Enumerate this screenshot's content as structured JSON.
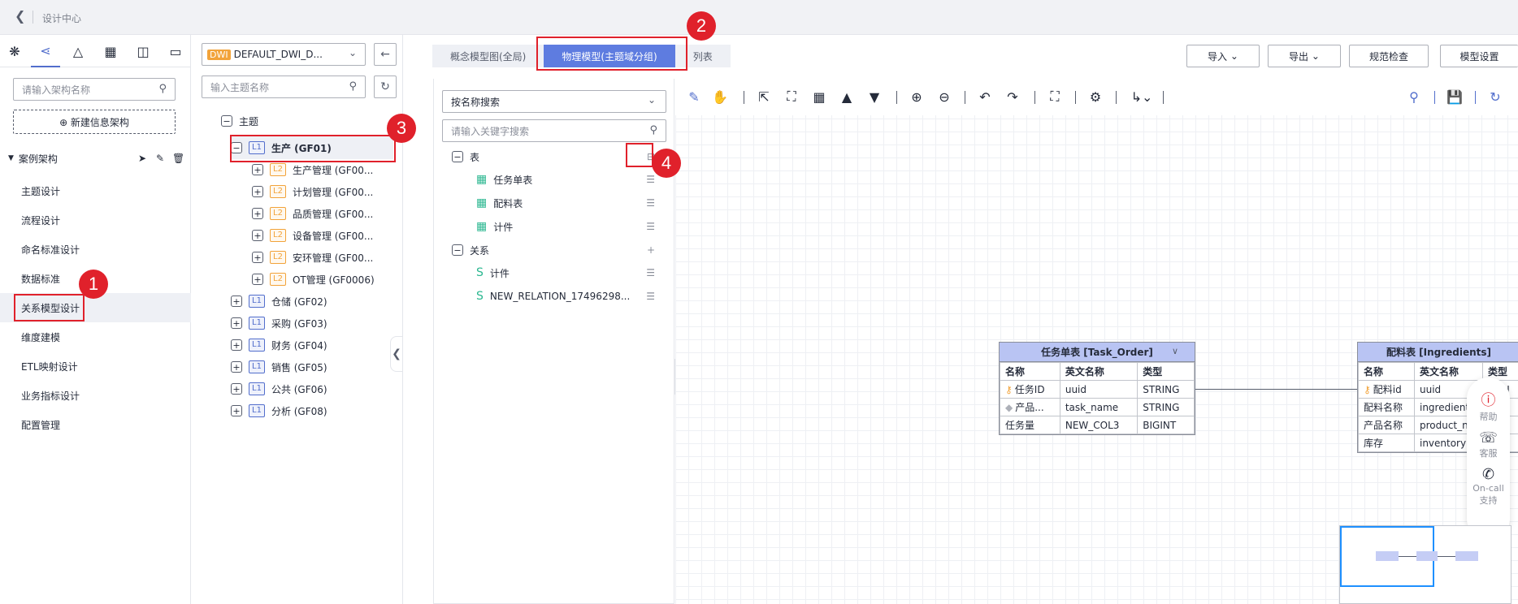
{
  "topbar": {
    "back_icon": "chevron-left-icon",
    "title": "设计中心"
  },
  "left1": {
    "search_placeholder": "请输入架构名称",
    "new_label": "⊕ 新建信息架构",
    "case_label": "案例架构",
    "nav": [
      "主题设计",
      "流程设计",
      "命名标准设计",
      "数据标准",
      "关系模型设计",
      "维度建模",
      "ETL映射设计",
      "业务指标设计",
      "配置管理"
    ],
    "active_nav": "关系模型设计"
  },
  "left2": {
    "workspace_tag": "DWI",
    "workspace": "DEFAULT_DWI_D...",
    "search_placeholder": "输入主题名称",
    "root": "主题",
    "l1_tag": "L1",
    "l2_tag": "L2",
    "selected": "生产 (GF01)",
    "children": [
      "生产管理 (GF00...",
      "计划管理 (GF00...",
      "品质管理 (GF00...",
      "设备管理 (GF00...",
      "安环管理 (GF00...",
      "OT管理 (GF0006)"
    ],
    "others": [
      "仓储 (GF02)",
      "采购 (GF03)",
      "财务 (GF04)",
      "销售 (GF05)",
      "公共 (GF06)",
      "分析 (GF08)"
    ]
  },
  "tabs": [
    "概念模型图(全局)",
    "物理模型(主题域分组)",
    "列表"
  ],
  "active_tab": "物理模型(主题域分组)",
  "actions": {
    "import": "导入",
    "export": "导出",
    "check": "规范检查",
    "settings": "模型设置"
  },
  "panel3": {
    "search_mode": "按名称搜索",
    "keyword_placeholder": "请输入关键字搜索",
    "tables_label": "表",
    "tables": [
      "任务单表",
      "配料表",
      "计件"
    ],
    "relations_label": "关系",
    "relations": [
      "计件",
      "NEW_RELATION_17496298..."
    ]
  },
  "entities": [
    {
      "title": "任务单表 [Task_Order]",
      "headers": [
        "名称",
        "英文名称",
        "类型"
      ],
      "rows": [
        [
          "任务ID",
          "uuid",
          "STRING"
        ],
        [
          "产品...",
          "task_name",
          "STRING"
        ],
        [
          "任务量",
          "NEW_COL3",
          "BIGINT"
        ]
      ]
    },
    {
      "title": "配料表 [Ingredients]",
      "headers": [
        "名称",
        "英文名称",
        "类型"
      ],
      "rows": [
        [
          "配料id",
          "uuid",
          "STRI"
        ],
        [
          "配料名称",
          "ingredient",
          "STRI"
        ],
        [
          "产品名称",
          "product_n",
          "STRI"
        ],
        [
          "库存",
          "inventory",
          "BIGI"
        ]
      ]
    }
  ],
  "help": {
    "help": "帮助",
    "service": "客服",
    "oncall": "On-call",
    "support": "支持"
  },
  "badges": [
    "1",
    "2",
    "3",
    "4"
  ]
}
